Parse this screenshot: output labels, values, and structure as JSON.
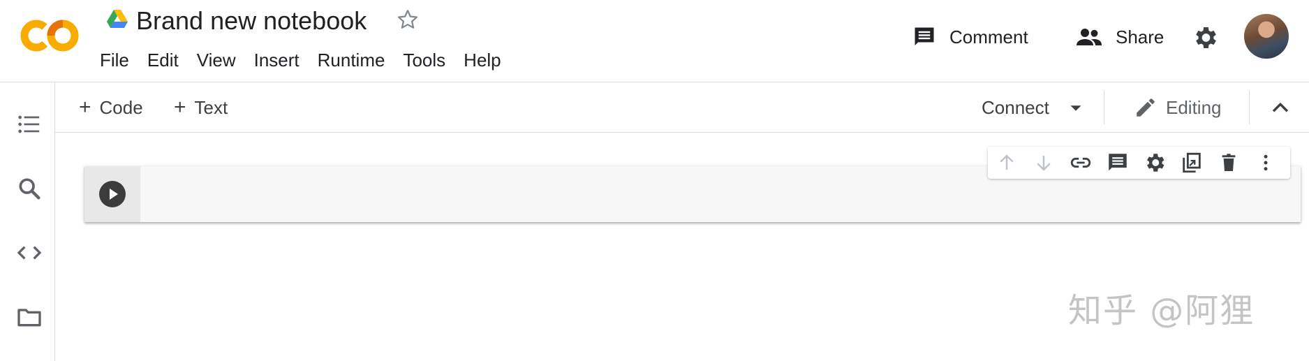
{
  "brand": {
    "logo_text": "CO",
    "colors": {
      "logo_orange": "#F9AB00",
      "logo_dark_orange": "#E8710A"
    }
  },
  "notebook": {
    "title": "Brand new notebook",
    "drive_icon": "google-drive-icon",
    "star_icon": "star-outline-icon"
  },
  "menu": {
    "items": [
      {
        "label": "File"
      },
      {
        "label": "Edit"
      },
      {
        "label": "View"
      },
      {
        "label": "Insert"
      },
      {
        "label": "Runtime"
      },
      {
        "label": "Tools"
      },
      {
        "label": "Help"
      }
    ]
  },
  "header_actions": {
    "comment_label": "Comment",
    "share_label": "Share",
    "settings_icon": "gear-icon",
    "avatar_icon": "user-avatar"
  },
  "sidebar": {
    "items": [
      {
        "icon": "table-of-contents-icon"
      },
      {
        "icon": "search-icon"
      },
      {
        "icon": "code-snippets-icon"
      },
      {
        "icon": "folder-icon"
      }
    ]
  },
  "toolbar": {
    "add_code_label": "Code",
    "add_text_label": "Text",
    "connect_label": "Connect",
    "editing_label": "Editing"
  },
  "cell_toolbar": {
    "icons": [
      "arrow-up-icon",
      "arrow-down-icon",
      "link-icon",
      "comment-icon",
      "gear-icon",
      "mirror-cell-icon",
      "delete-icon",
      "more-vert-icon"
    ]
  },
  "watermark": {
    "text": "知乎 @阿狸"
  }
}
